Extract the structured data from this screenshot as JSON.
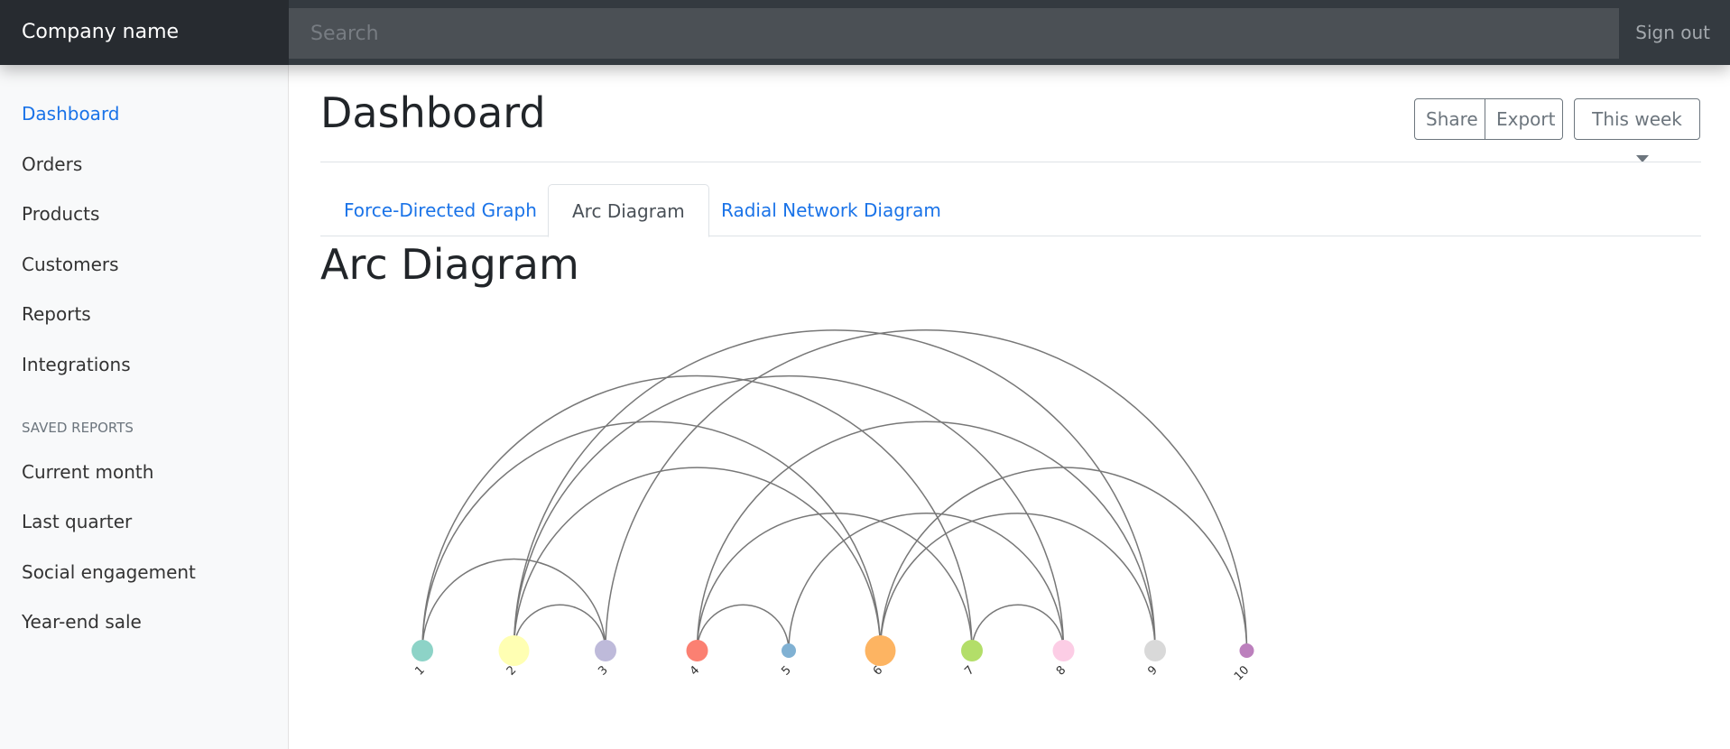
{
  "navbar": {
    "brand": "Company name",
    "search_placeholder": "Search",
    "signout": "Sign out"
  },
  "sidebar": {
    "items": [
      {
        "label": "Dashboard",
        "active": true
      },
      {
        "label": "Orders"
      },
      {
        "label": "Products"
      },
      {
        "label": "Customers"
      },
      {
        "label": "Reports"
      },
      {
        "label": "Integrations"
      }
    ],
    "saved_heading": "Saved reports",
    "saved": [
      {
        "label": "Current month"
      },
      {
        "label": "Last quarter"
      },
      {
        "label": "Social engagement"
      },
      {
        "label": "Year-end sale"
      }
    ]
  },
  "main": {
    "title": "Dashboard",
    "buttons": {
      "share": "Share",
      "export": "Export",
      "period": "This week"
    },
    "tabs": [
      {
        "label": "Force-Directed Graph"
      },
      {
        "label": "Arc Diagram",
        "active": true
      },
      {
        "label": "Radial Network Diagram"
      }
    ],
    "section_title": "Arc Diagram"
  },
  "chart_data": {
    "type": "arc",
    "nodes": [
      {
        "id": "1",
        "size": "medium",
        "color": "#8dd3c7"
      },
      {
        "id": "2",
        "size": "large",
        "color": "#ffffb3"
      },
      {
        "id": "3",
        "size": "medium",
        "color": "#bebada"
      },
      {
        "id": "4",
        "size": "medium",
        "color": "#fb8072"
      },
      {
        "id": "5",
        "size": "small",
        "color": "#80b1d3"
      },
      {
        "id": "6",
        "size": "large",
        "color": "#fdb462"
      },
      {
        "id": "7",
        "size": "medium",
        "color": "#b3de69"
      },
      {
        "id": "8",
        "size": "medium",
        "color": "#fccde5"
      },
      {
        "id": "9",
        "size": "medium",
        "color": "#d9d9d9"
      },
      {
        "id": "10",
        "size": "small",
        "color": "#bc80bd"
      }
    ],
    "links": [
      [
        "1",
        "3"
      ],
      [
        "2",
        "3"
      ],
      [
        "4",
        "5"
      ],
      [
        "7",
        "8"
      ],
      [
        "1",
        "7"
      ],
      [
        "2",
        "8"
      ],
      [
        "2",
        "9"
      ],
      [
        "3",
        "10"
      ],
      [
        "1",
        "6"
      ],
      [
        "4",
        "9"
      ],
      [
        "2",
        "6"
      ],
      [
        "6",
        "10"
      ],
      [
        "4",
        "7"
      ],
      [
        "5",
        "8"
      ],
      [
        "6",
        "9"
      ]
    ],
    "link_color": "#777777"
  }
}
